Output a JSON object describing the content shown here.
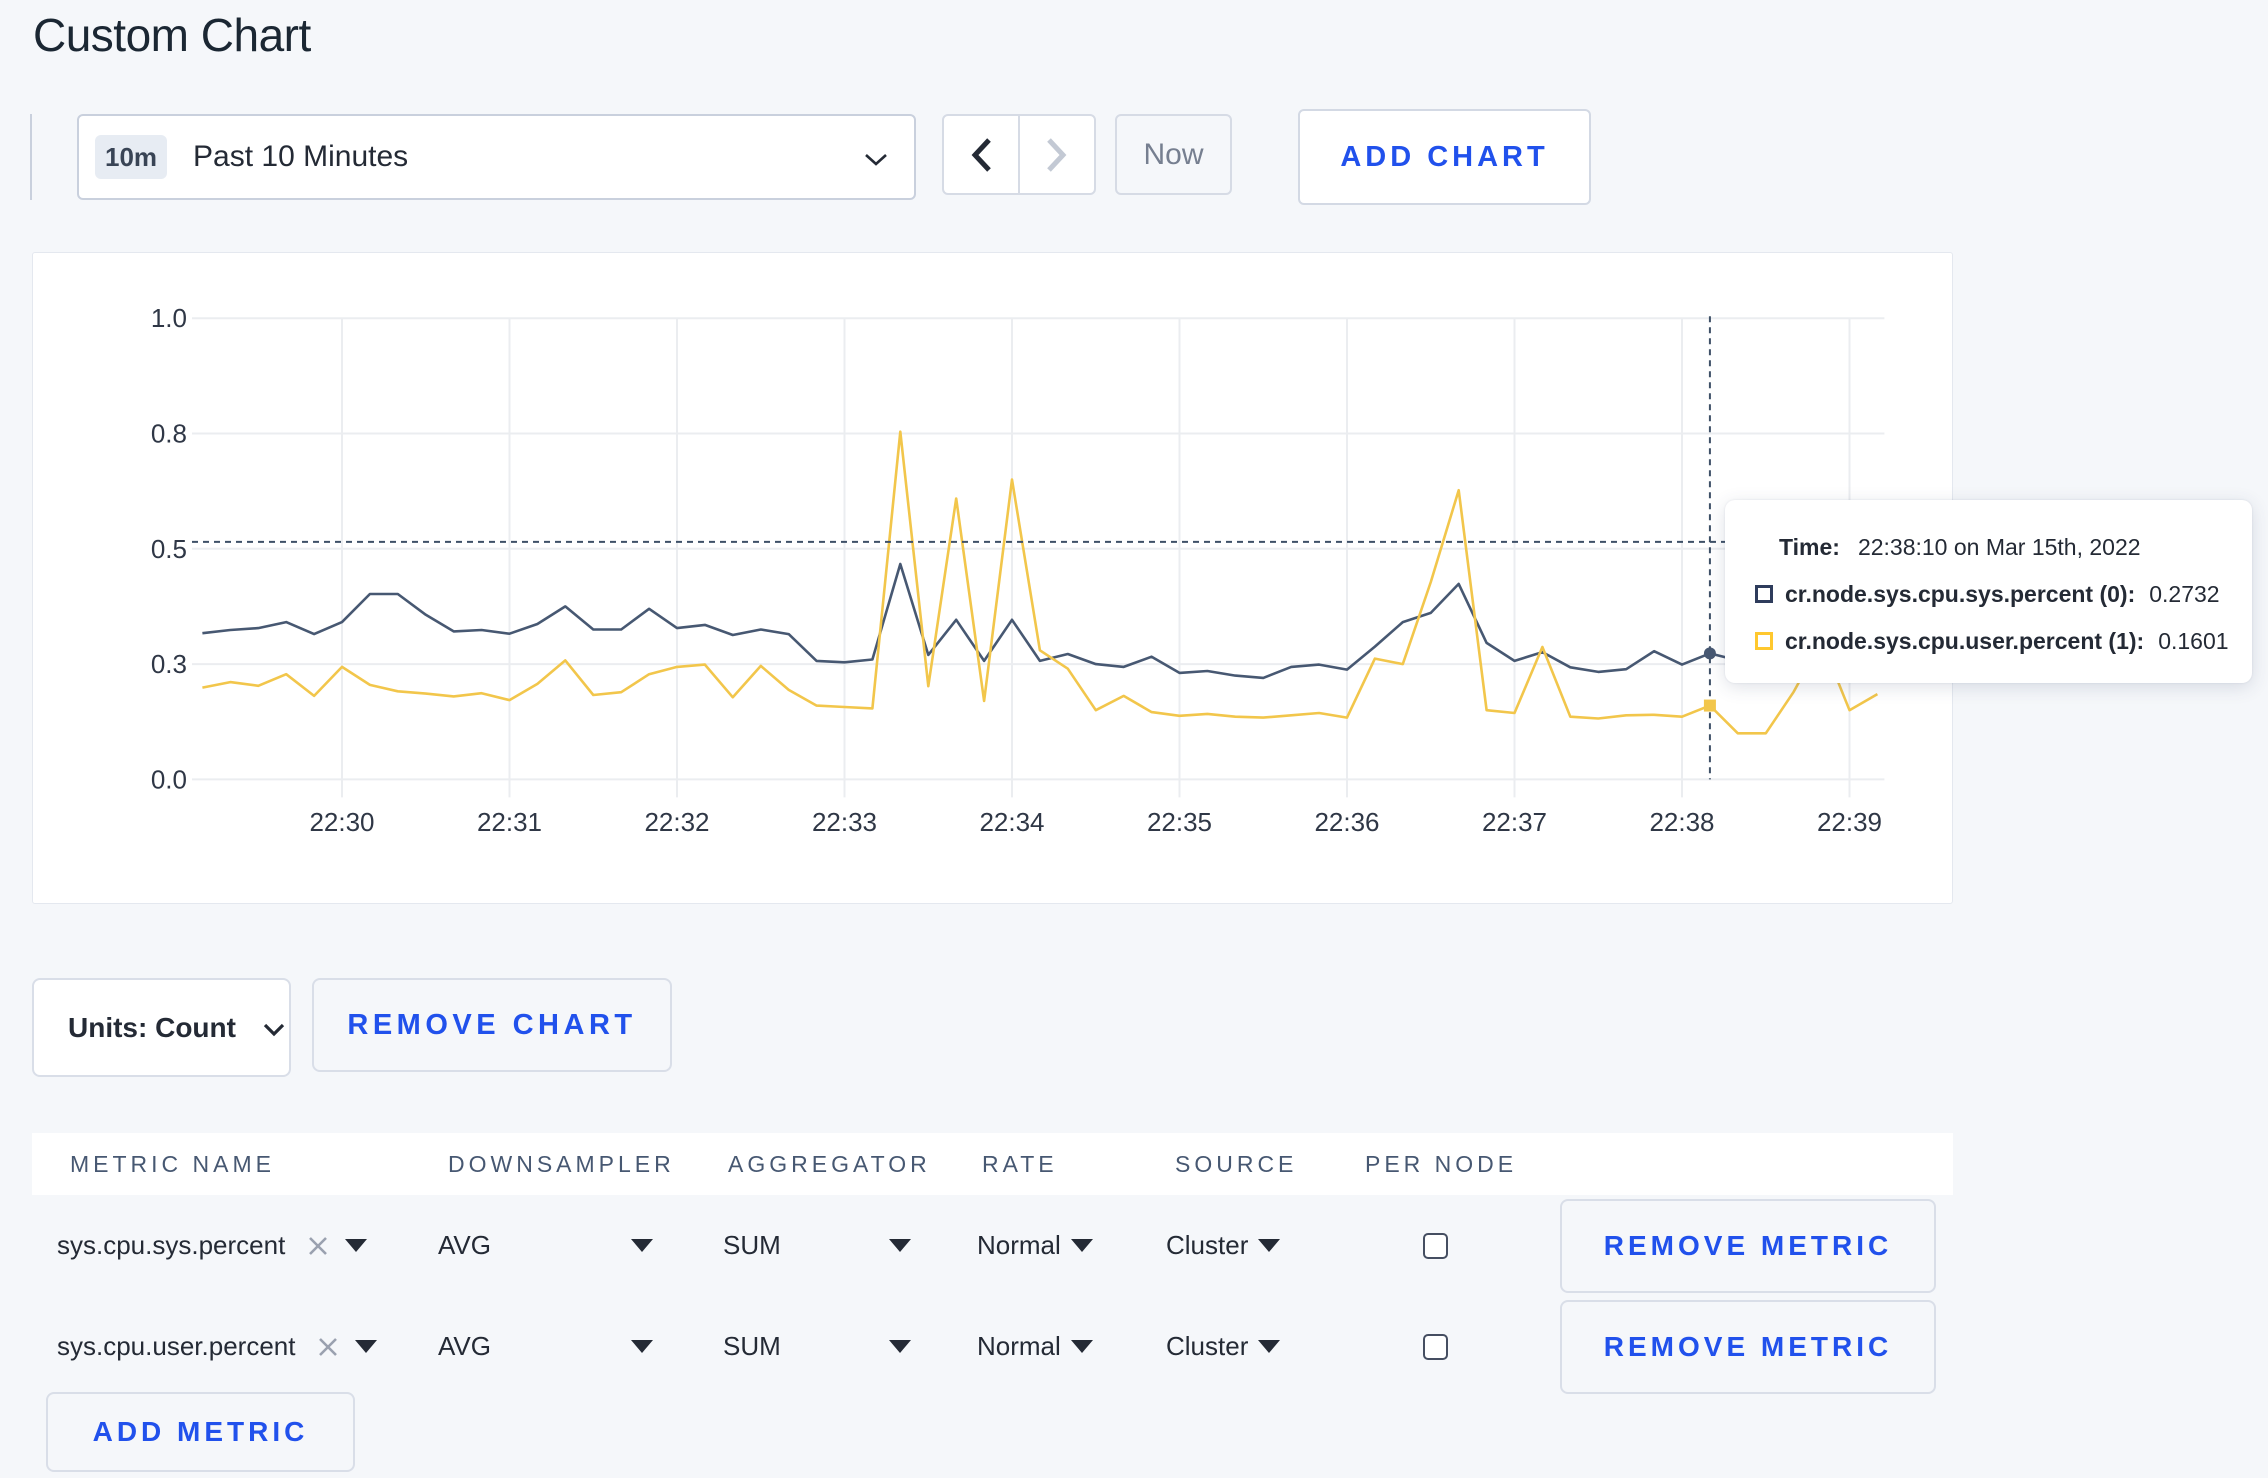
{
  "page": {
    "title": "Custom Chart",
    "background_color": "#f5f7fa",
    "accent_blue": "#2151ec"
  },
  "toolbar": {
    "time_window_badge": "10m",
    "time_window_label": "Past 10 Minutes",
    "now_label": "Now",
    "add_chart_label": "ADD CHART"
  },
  "chart_data": {
    "type": "line",
    "title": "",
    "xlabel": "",
    "ylabel": "",
    "ylim": [
      0,
      1
    ],
    "grid": true,
    "legend_position": "tooltip",
    "y_gridline_values": [
      0,
      0.25,
      0.5,
      0.75,
      1
    ],
    "y_tick_labels": [
      "0.0",
      "0.3",
      "0.5",
      "0.8",
      "1.0"
    ],
    "x_tick_labels": [
      "22:30",
      "22:31",
      "22:32",
      "22:33",
      "22:34",
      "22:35",
      "22:36",
      "22:37",
      "22:38",
      "22:39"
    ],
    "x": [
      "22:29:10",
      "22:29:20",
      "22:29:30",
      "22:29:40",
      "22:29:50",
      "22:30:00",
      "22:30:10",
      "22:30:20",
      "22:30:30",
      "22:30:40",
      "22:30:50",
      "22:31:00",
      "22:31:10",
      "22:31:20",
      "22:31:30",
      "22:31:40",
      "22:31:50",
      "22:32:00",
      "22:32:10",
      "22:32:20",
      "22:32:30",
      "22:32:40",
      "22:32:50",
      "22:33:00",
      "22:33:10",
      "22:33:20",
      "22:33:30",
      "22:33:40",
      "22:33:50",
      "22:34:00",
      "22:34:10",
      "22:34:20",
      "22:34:30",
      "22:34:40",
      "22:34:50",
      "22:35:00",
      "22:35:10",
      "22:35:20",
      "22:35:30",
      "22:35:40",
      "22:35:50",
      "22:36:00",
      "22:36:10",
      "22:36:20",
      "22:36:30",
      "22:36:40",
      "22:36:50",
      "22:37:00",
      "22:37:10",
      "22:37:20",
      "22:37:30",
      "22:37:40",
      "22:37:50",
      "22:38:00",
      "22:38:10",
      "22:38:20",
      "22:38:30",
      "22:38:40",
      "22:38:50",
      "22:39:00",
      "22:39:10"
    ],
    "series": [
      {
        "name": "cr.node.sys.cpu.sys.percent",
        "color": "#475872",
        "values": [
          0.317,
          0.324,
          0.328,
          0.341,
          0.315,
          0.341,
          0.402,
          0.402,
          0.357,
          0.321,
          0.324,
          0.316,
          0.337,
          0.375,
          0.325,
          0.325,
          0.37,
          0.328,
          0.335,
          0.313,
          0.325,
          0.315,
          0.257,
          0.254,
          0.26,
          0.467,
          0.27,
          0.346,
          0.257,
          0.346,
          0.257,
          0.272,
          0.25,
          0.244,
          0.266,
          0.231,
          0.235,
          0.225,
          0.22,
          0.244,
          0.249,
          0.238,
          0.288,
          0.341,
          0.361,
          0.424,
          0.296,
          0.257,
          0.276,
          0.243,
          0.233,
          0.239,
          0.278,
          0.249,
          0.2732,
          0.258,
          0.276,
          0.296,
          0.288,
          0.305,
          0.298
        ]
      },
      {
        "name": "cr.node.sys.cpu.user.percent",
        "color": "#f2c64b",
        "values": [
          0.199,
          0.211,
          0.203,
          0.228,
          0.181,
          0.244,
          0.205,
          0.191,
          0.186,
          0.18,
          0.187,
          0.172,
          0.207,
          0.258,
          0.183,
          0.189,
          0.228,
          0.244,
          0.249,
          0.178,
          0.246,
          0.194,
          0.16,
          0.157,
          0.154,
          0.754,
          0.202,
          0.609,
          0.17,
          0.65,
          0.28,
          0.24,
          0.15,
          0.181,
          0.146,
          0.138,
          0.142,
          0.136,
          0.134,
          0.139,
          0.144,
          0.134,
          0.262,
          0.25,
          0.428,
          0.627,
          0.15,
          0.144,
          0.287,
          0.136,
          0.132,
          0.139,
          0.14,
          0.136,
          0.1601,
          0.1,
          0.1,
          0.19,
          0.3,
          0.15,
          0.185
        ]
      }
    ],
    "crosshair": {
      "x_time": "22:38:10",
      "y_value": 0.515
    }
  },
  "tooltip": {
    "time_label": "Time:",
    "time_value": "22:38:10 on Mar 15th, 2022",
    "rows": [
      {
        "label": "cr.node.sys.cpu.sys.percent (0):",
        "value": "0.2732",
        "marker_color": "#2e3c5c"
      },
      {
        "label": "cr.node.sys.cpu.user.percent (1):",
        "value": "0.1601",
        "marker_color": "#ffc82e"
      }
    ]
  },
  "chart_controls": {
    "units_label": "Units: Count",
    "remove_chart_label": "REMOVE CHART"
  },
  "metrics_table": {
    "headers": [
      "METRIC NAME",
      "DOWNSAMPLER",
      "AGGREGATOR",
      "RATE",
      "SOURCE",
      "PER NODE"
    ],
    "rows": [
      {
        "metric_name": "sys.cpu.sys.percent",
        "downsampler": "AVG",
        "aggregator": "SUM",
        "rate": "Normal",
        "source": "Cluster",
        "per_node": false,
        "remove_label": "REMOVE METRIC"
      },
      {
        "metric_name": "sys.cpu.user.percent",
        "downsampler": "AVG",
        "aggregator": "SUM",
        "rate": "Normal",
        "source": "Cluster",
        "per_node": false,
        "remove_label": "REMOVE METRIC"
      }
    ],
    "add_metric_label": "ADD METRIC"
  }
}
